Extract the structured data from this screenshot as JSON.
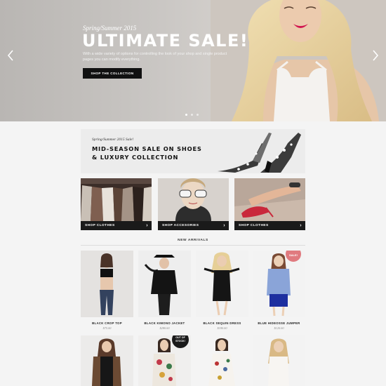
{
  "hero": {
    "kicker": "Spring/Summer 2015",
    "title": "ULTIMATE SALE!",
    "description": "With a wide variety of options for controlling the look of your shop and single product pages you can modify everything.",
    "cta_label": "SHOP THE COLLECTION",
    "slide_count": 3,
    "active_slide": 1
  },
  "promo": {
    "kicker": "Spring/Summer 2015 Sale!",
    "title": "MID-SEASON SALE ON SHOES & LUXURY COLLECTION"
  },
  "categories": [
    {
      "label": "SHOP CLOTHES"
    },
    {
      "label": "SHOP ACCESORIES"
    },
    {
      "label": "SHOP CLOTHES"
    }
  ],
  "section_title": "NEW ARRIVALS",
  "products": [
    {
      "name": "BLACK CROP TOP",
      "price": "$75.00"
    },
    {
      "name": "BLACK KIMONO JACKET",
      "price": "$280.00"
    },
    {
      "name": "BLACK SEQUIN DRESS",
      "price": "$180.00"
    },
    {
      "name": "BLUE HIDEOSSE JUMPER",
      "price": "$120.00",
      "badge": "SALE!"
    },
    {
      "name": "",
      "price": ""
    },
    {
      "name": "",
      "price": "",
      "badge": "OUT OF STOCK!"
    },
    {
      "name": "",
      "price": ""
    },
    {
      "name": "",
      "price": ""
    }
  ],
  "colors": {
    "sale_badge": "#e07a7f",
    "stock_badge": "#1a1a1a",
    "dark_bar": "#1a1a1a",
    "page_bg": "#f4f4f4"
  }
}
